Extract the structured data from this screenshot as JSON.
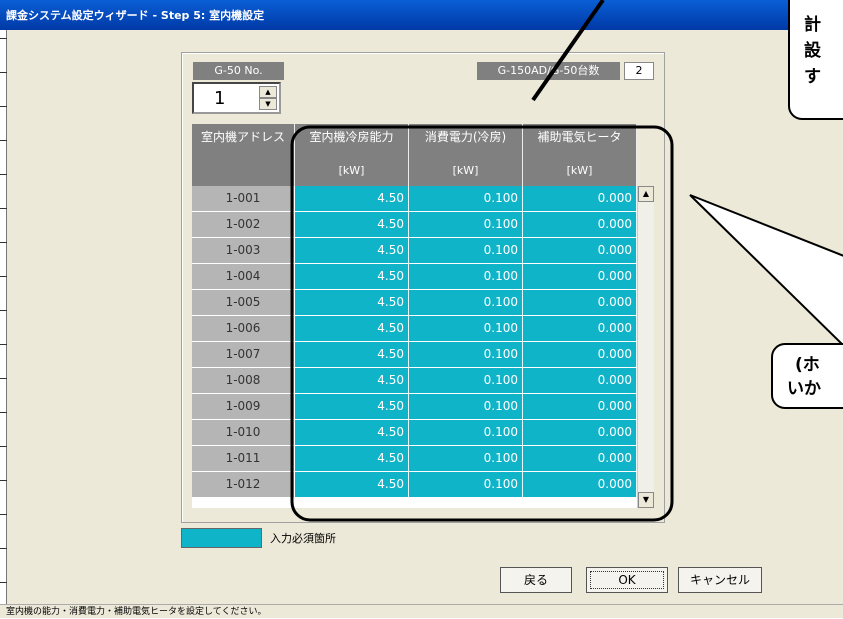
{
  "window": {
    "title": "課金システム設定ウィザード - Step 5: 室内機設定"
  },
  "g50": {
    "label": "G-50 No.",
    "value": "1"
  },
  "unit_count": {
    "label": "G-150AD/G-50台数",
    "value": "2"
  },
  "table": {
    "columns": [
      {
        "title": "室内機アドレス",
        "unit": ""
      },
      {
        "title": "室内機冷房能力",
        "unit": "[kW]"
      },
      {
        "title": "消費電力(冷房)",
        "unit": "[kW]"
      },
      {
        "title": "補助電気ヒータ",
        "unit": "[kW]"
      }
    ],
    "rows": [
      {
        "address": "1-001",
        "capacity": "4.50",
        "power": "0.100",
        "heater": "0.000"
      },
      {
        "address": "1-002",
        "capacity": "4.50",
        "power": "0.100",
        "heater": "0.000"
      },
      {
        "address": "1-003",
        "capacity": "4.50",
        "power": "0.100",
        "heater": "0.000"
      },
      {
        "address": "1-004",
        "capacity": "4.50",
        "power": "0.100",
        "heater": "0.000"
      },
      {
        "address": "1-005",
        "capacity": "4.50",
        "power": "0.100",
        "heater": "0.000"
      },
      {
        "address": "1-006",
        "capacity": "4.50",
        "power": "0.100",
        "heater": "0.000"
      },
      {
        "address": "1-007",
        "capacity": "4.50",
        "power": "0.100",
        "heater": "0.000"
      },
      {
        "address": "1-008",
        "capacity": "4.50",
        "power": "0.100",
        "heater": "0.000"
      },
      {
        "address": "1-009",
        "capacity": "4.50",
        "power": "0.100",
        "heater": "0.000"
      },
      {
        "address": "1-010",
        "capacity": "4.50",
        "power": "0.100",
        "heater": "0.000"
      },
      {
        "address": "1-011",
        "capacity": "4.50",
        "power": "0.100",
        "heater": "0.000"
      },
      {
        "address": "1-012",
        "capacity": "4.50",
        "power": "0.100",
        "heater": "0.000"
      }
    ]
  },
  "legend": {
    "label": "入力必須箇所",
    "color": "#10b4c8"
  },
  "buttons": {
    "back": "戻る",
    "ok": "OK",
    "cancel": "キャンセル"
  },
  "status_text": "室内機の能力・消費電力・補助電気ヒータを設定してください。",
  "callouts": {
    "top_lines": [
      "計",
      "設",
      "す"
    ],
    "bottom_lines": [
      "(ホ",
      "いか"
    ]
  },
  "icons": {
    "spin_up": "up-arrow-icon",
    "spin_down": "down-arrow-icon",
    "scroll_up": "scroll-up-arrow-icon",
    "scroll_down": "scroll-down-arrow-icon"
  },
  "colors": {
    "title_bar": "#0039a6",
    "required_cell": "#10b4c8",
    "header": "#808080",
    "address_cell": "#b5b5b5"
  }
}
